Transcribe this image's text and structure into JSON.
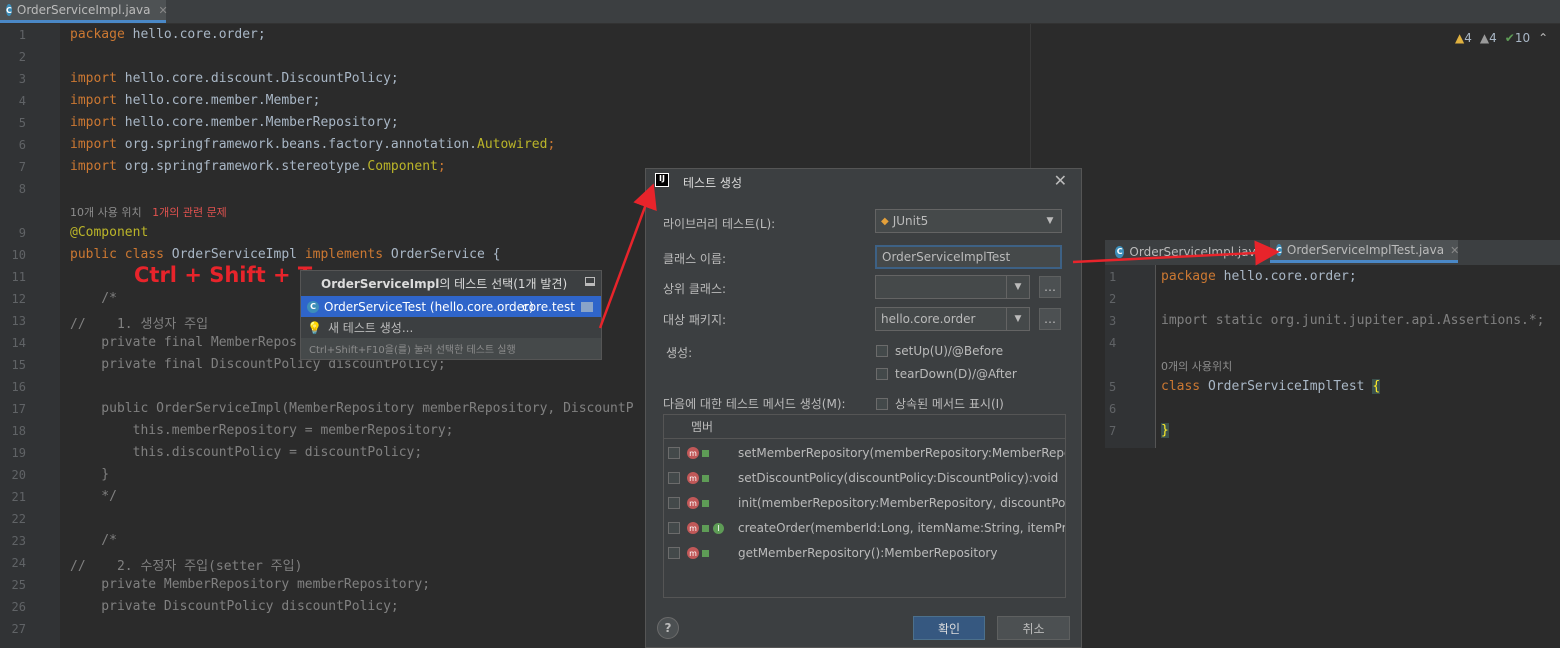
{
  "tabs": {
    "main_file": "OrderServiceImpl.java"
  },
  "inspections": {
    "warnings_a": "4",
    "warnings_b": "4",
    "ok_count": "10"
  },
  "editor": {
    "line_numbers": [
      "1",
      "2",
      "3",
      "4",
      "5",
      "6",
      "7",
      "8",
      "9",
      "10",
      "11",
      "12",
      "13",
      "14",
      "15",
      "16",
      "17",
      "18",
      "19",
      "20",
      "21",
      "22",
      "23",
      "24",
      "25",
      "26",
      "27"
    ],
    "usage_hint": "10개 사용 위치",
    "problem_hint": "1개의 관련 문제",
    "lines": {
      "l1_kw": "package",
      "l1_rest": " hello.core.order;",
      "l3_kw": "import",
      "l3_rest": " hello.core.discount.DiscountPolicy;",
      "l4_kw": "import",
      "l4_rest": " hello.core.member.Member;",
      "l5_kw": "import",
      "l5_rest": " hello.core.member.MemberRepository;",
      "l6_kw": "import",
      "l6_rest": " org.springframework.beans.factory.annotation.",
      "l6_ann": "Autowired",
      "l6_end": ";",
      "l7_kw": "import",
      "l7_rest": " org.springframework.stereotype.",
      "l7_ann": "Component",
      "l7_end": ";",
      "l9_ann": "@Component",
      "l10_kw1": "public class",
      "l10_mid": " OrderServiceImpl ",
      "l10_kw2": "implements",
      "l10_end": " OrderService {",
      "l12": "    /*",
      "l13": "//    1. 생성자 주입",
      "l14": "    private final MemberRepos",
      "l15": "    private final DiscountPolicy discountPolicy;",
      "l17": "    public OrderServiceImpl(MemberRepository memberRepository, DiscountP",
      "l18": "        this.memberRepository = memberRepository;",
      "l19": "        this.discountPolicy = discountPolicy;",
      "l20": "    }",
      "l21": "    */",
      "l23": "    /*",
      "l24": "//    2. 수정자 주입(setter 주입)",
      "l25": "    private MemberRepository memberRepository;",
      "l26": "    private DiscountPolicy discountPolicy;"
    }
  },
  "shortcut_label": "Ctrl + Shift + T",
  "popup": {
    "title_bold": "OrderServiceImpl",
    "title_rest": "의 테스트 선택(1개 발견)",
    "item_test": "OrderServiceTest (hello.core.order)",
    "item_test_pkg": "core.test",
    "item_new": "새 테스트 생성...",
    "footer": "Ctrl+Shift+F10을(를) 눌러 선택한 테스트 실행"
  },
  "dialog": {
    "title": "테스트 생성",
    "library_label": "라이브러리 테스트(L):",
    "library_value": "JUnit5",
    "class_label": "클래스 이름:",
    "class_value": "OrderServiceImplTest",
    "super_label": "상위 클래스:",
    "super_value": "",
    "package_label": "대상 패키지:",
    "package_value": "hello.core.order",
    "generate_label": "생성:",
    "setup_label": "setUp(U)/@Before",
    "teardown_label": "tearDown(D)/@After",
    "methods_label": "다음에 대한 테스트 메서드 생성(M):",
    "inherited_label": "상속된 메서드 표시(I)",
    "members_header": "멤버",
    "members": [
      "setMemberRepository(memberRepository:MemberRepository",
      "setDiscountPolicy(discountPolicy:DiscountPolicy):void",
      "init(memberRepository:MemberRepository, discountPolicy:Di",
      "createOrder(memberId:Long, itemName:String, itemPrice:int)",
      "getMemberRepository():MemberRepository"
    ],
    "help": "?",
    "ok": "확인",
    "cancel": "취소"
  },
  "right_editor": {
    "tab1": "OrderServiceImpl.java",
    "tab2": "OrderServiceImplTest.java",
    "line_numbers": [
      "1",
      "2",
      "3",
      "4",
      "5",
      "6",
      "7"
    ],
    "l1_kw": "package",
    "l1_rest": " hello.core.order;",
    "l3_kw": "import static",
    "l3_rest": " org.junit.jupiter.api.Assertions.*;",
    "usage_hint": "0개의 사용위치",
    "l5_kw": "class",
    "l5_rest": " OrderServiceImplTest ",
    "l5_brace": "{",
    "l7_brace": "}"
  },
  "colors": {
    "arrow": "#e8242b",
    "accent": "#4a88c7",
    "selection": "#2f65ca"
  }
}
